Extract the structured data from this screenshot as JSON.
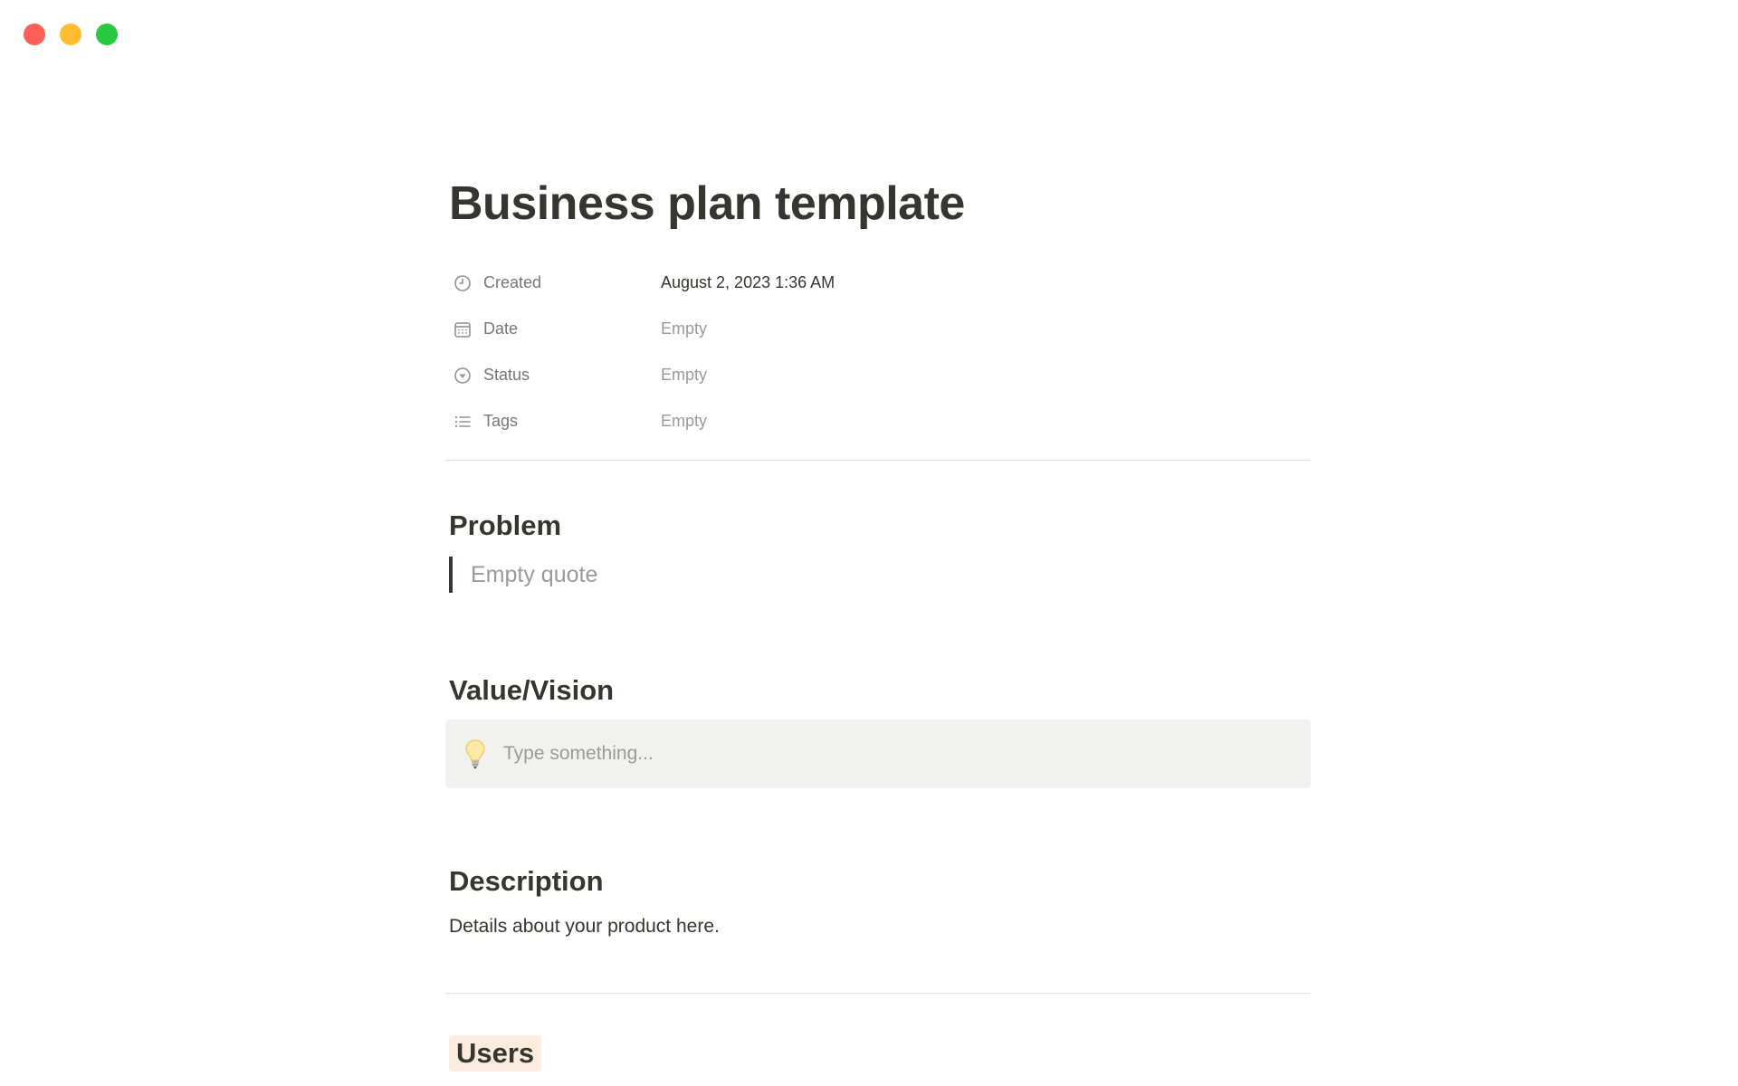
{
  "window": {
    "controls": {
      "close_color": "#ff5f57",
      "minimize_color": "#febc2e",
      "zoom_color": "#28c840"
    }
  },
  "page": {
    "title": "Business plan template",
    "properties": [
      {
        "icon": "clock-icon",
        "name": "Created",
        "value": "August 2, 2023 1:36 AM",
        "empty": false
      },
      {
        "icon": "calendar-icon",
        "name": "Date",
        "value": "Empty",
        "empty": true
      },
      {
        "icon": "status-icon",
        "name": "Status",
        "value": "Empty",
        "empty": true
      },
      {
        "icon": "list-icon",
        "name": "Tags",
        "value": "Empty",
        "empty": true
      }
    ]
  },
  "sections": {
    "problem": {
      "heading": "Problem",
      "quote_placeholder": "Empty quote"
    },
    "value_vision": {
      "heading": "Value/Vision",
      "callout_icon": "lightbulb-icon",
      "callout_placeholder": "Type something..."
    },
    "description": {
      "heading": "Description",
      "text": "Details about your product here."
    },
    "users": {
      "heading": "Users",
      "highlight_color": "#fbecdd"
    }
  }
}
